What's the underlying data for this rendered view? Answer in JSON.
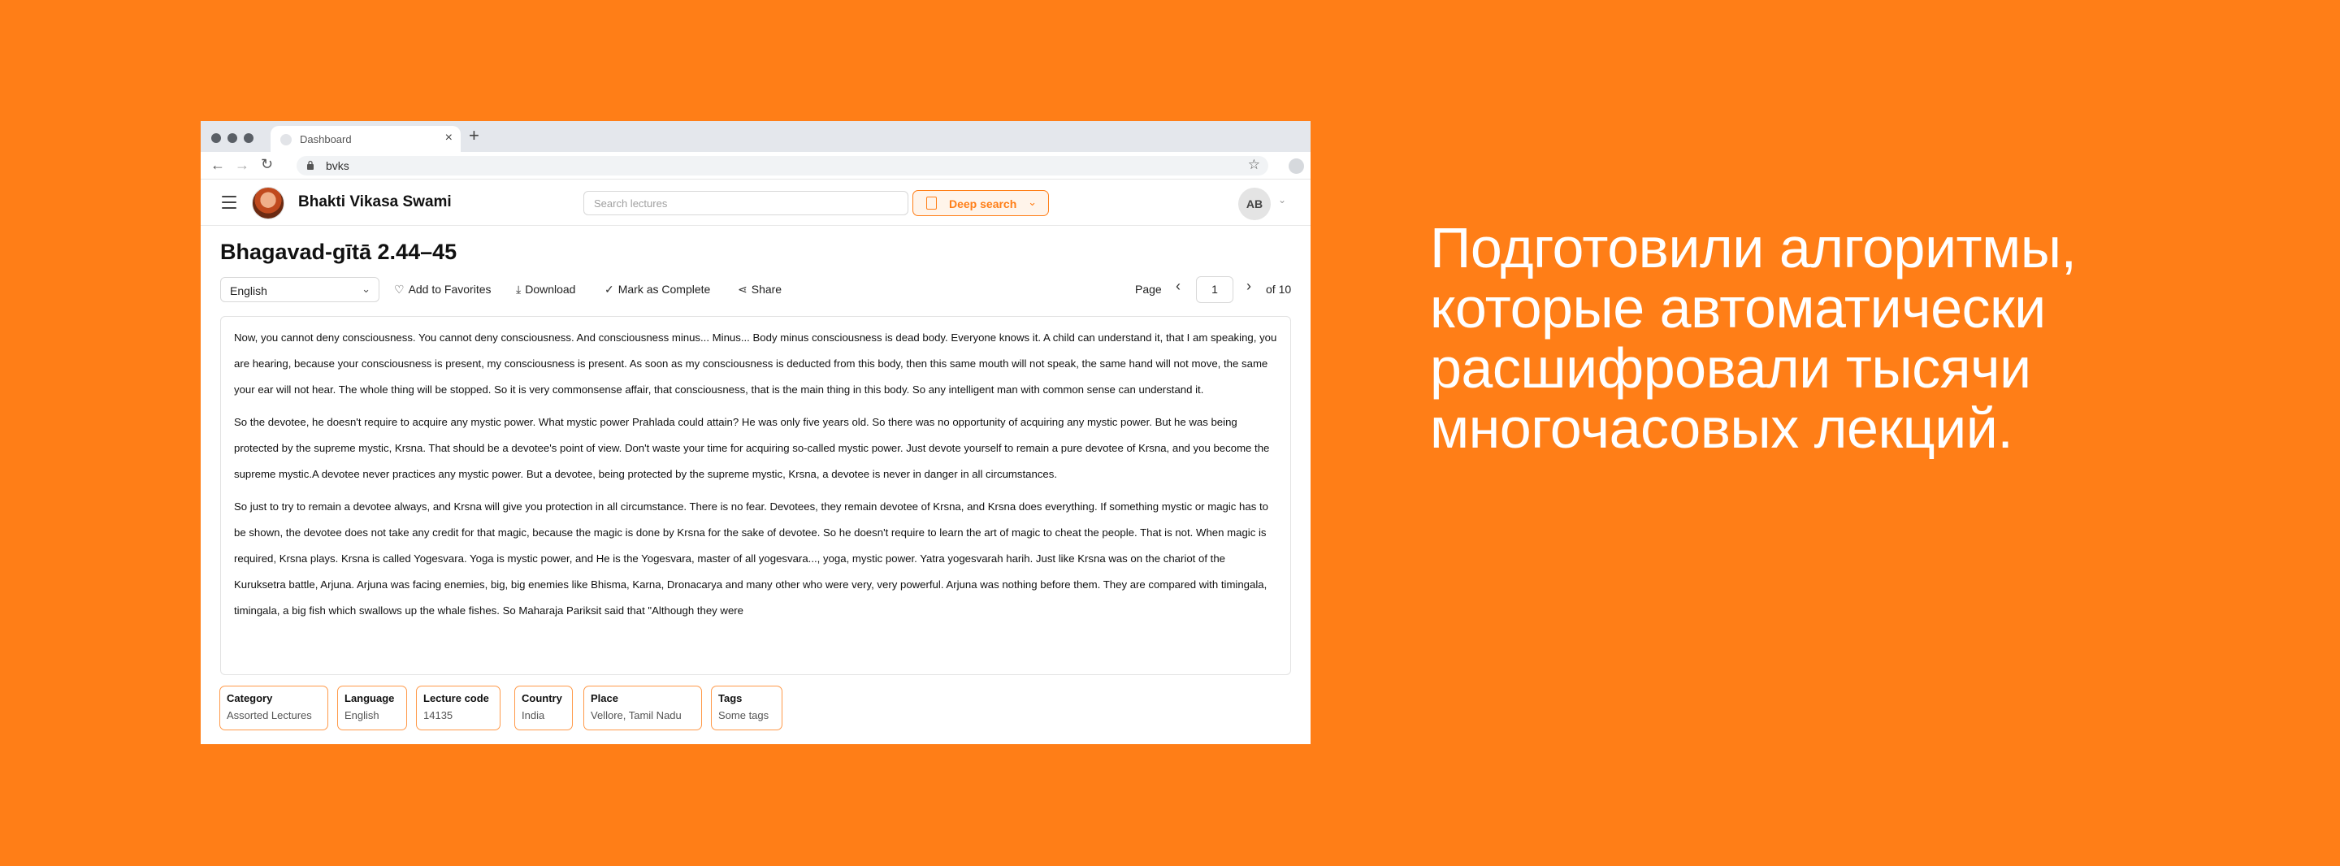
{
  "browser": {
    "tab_title": "Dashboard",
    "tab_close": "×",
    "new_tab": "+",
    "url": "bvks"
  },
  "header": {
    "site_name": "Bhakti Vikasa Swami",
    "search_placeholder": "Search lectures",
    "deep_search_label": "Deep search",
    "user_initials": "AB"
  },
  "lecture": {
    "title": "Bhagavad-gītā 2.44–45",
    "language_selected": "English",
    "actions": {
      "favorites": "Add to Favorites",
      "download": "Download",
      "complete": "Mark as Complete",
      "share": "Share"
    },
    "pager": {
      "label": "Page",
      "current": "1",
      "of": "of 10"
    },
    "paragraphs": [
      "Now, you cannot deny consciousness. You cannot deny consciousness. And consciousness minus... Minus... Body minus consciousness is dead body. Everyone knows it. A child can understand it, that I am speaking, you are hearing, because your consciousness is present, my consciousness is present. As soon as my consciousness is deducted from this body, then this same mouth will not speak, the same hand will not move, the same your ear will not hear. The whole thing will be stopped. So it is very commonsense affair, that consciousness, that is the main thing in this body. So any intelligent man with common sense can understand it.",
      "So the devotee, he doesn't require to acquire any mystic power. What mystic power Prahlada could attain? He was only five years old. So there was no opportunity of acquiring any mystic power. But he was being protected by the supreme mystic, Krsna. That should be a devotee's point of view. Don't waste your time for acquiring so-called mystic power. Just devote yourself to remain a pure devotee of Krsna, and you become the supreme mystic.A devotee never practices any mystic power. But a devotee, being protected by the supreme mystic, Krsna, a devotee is never in danger in all circumstances.",
      "So just to try to remain a devotee always, and Krsna will give you protection in all circumstance. There is no fear. Devotees, they remain devotee of Krsna, and Krsna does everything. If something mystic or magic has to be shown, the devotee does not take any credit for that magic, because the magic is done by Krsna for the sake of devotee. So he doesn't require to learn the art of magic to cheat the people. That is not. When magic is required, Krsna plays. Krsna is called Yogesvara. Yoga is mystic power, and He is the Yogesvara, master of all yogesvara..., yoga, mystic power. Yatra yogesvarah harih. Just like Krsna was on the chariot of the Kuruksetra battle, Arjuna. Arjuna was facing enemies, big, big enemies like Bhisma, Karna, Dronacarya and many other who were very, very powerful. Arjuna was nothing before them. They are compared with timingala, timingala, a big fish which swallows up the whale fishes. So Maharaja Pariksit said that \"Although they were"
    ],
    "meta": [
      {
        "key": "Category",
        "value": "Assorted Lectures"
      },
      {
        "key": "Language",
        "value": "English"
      },
      {
        "key": "Lecture code",
        "value": "14135"
      },
      {
        "key": "Country",
        "value": "India"
      },
      {
        "key": "Place",
        "value": "Vellore, Tamil Nadu"
      },
      {
        "key": "Tags",
        "value": "Some tags"
      }
    ]
  },
  "headline": {
    "lines": [
      "Подготовили алгоритмы,",
      "которые автоматически",
      "расшифровали тысячи",
      "многочасовых лекций."
    ]
  },
  "colors": {
    "brand_orange": "#FF7E17",
    "chrome_gray": "#E4E7EC"
  },
  "icons": {
    "back": "arrow-left-icon",
    "forward": "arrow-right-icon",
    "reload": "reload-icon",
    "lock": "lock-icon",
    "bookmark": "star-icon",
    "menu": "hamburger-icon",
    "deep_search": "document-search-icon",
    "favorites": "heart-icon",
    "download": "download-icon",
    "complete": "check-icon",
    "share": "share-icon"
  }
}
